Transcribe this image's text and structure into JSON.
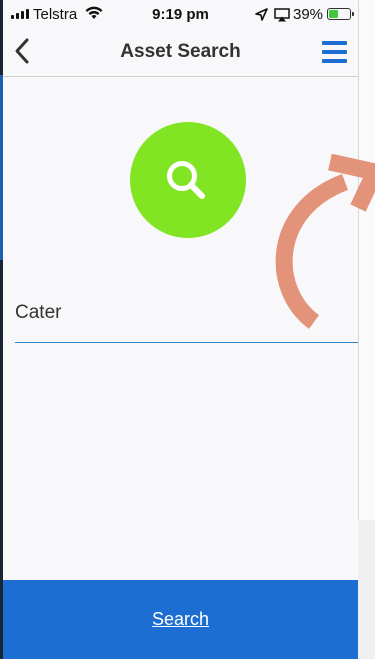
{
  "status_bar": {
    "carrier": "Telstra",
    "time": "9:19 pm",
    "battery_percent": "39%",
    "battery_level": 0.39,
    "icons": [
      "signal-icon",
      "wifi-icon",
      "location-arrow-icon",
      "airplay-icon",
      "battery-icon"
    ]
  },
  "nav": {
    "title": "Asset Search",
    "back_icon": "chevron-left-icon",
    "menu_icon": "hamburger-menu-icon"
  },
  "hero": {
    "icon": "magnifier-icon",
    "color": "#82e524"
  },
  "search": {
    "value": "Cater",
    "underline_color": "#2a86c7"
  },
  "footer": {
    "button_label": "Search",
    "color": "#1d6ed3"
  },
  "overlay": {
    "icon": "swipe-gesture-arrow-icon",
    "color": "#e0876b"
  }
}
